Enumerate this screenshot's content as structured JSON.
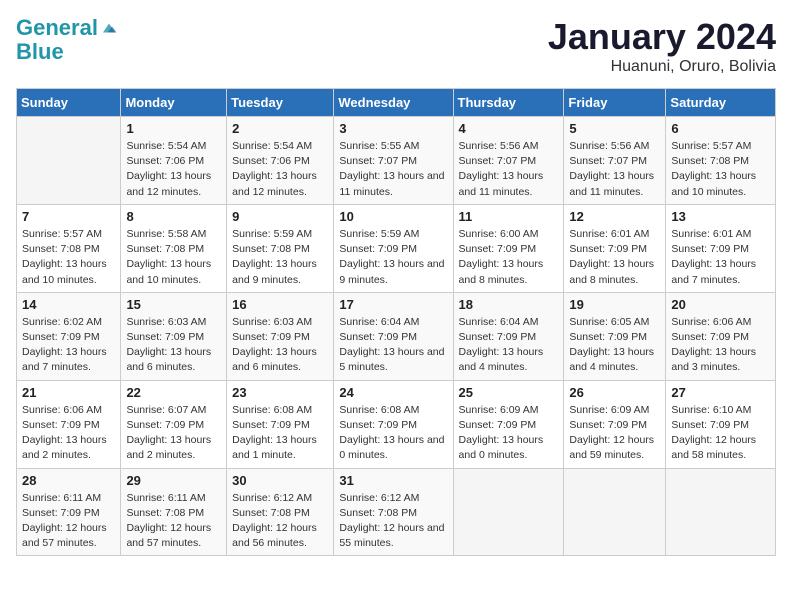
{
  "logo": {
    "line1": "General",
    "line2": "Blue"
  },
  "title": "January 2024",
  "subtitle": "Huanuni, Oruro, Bolivia",
  "header_color": "#2970b8",
  "days_of_week": [
    "Sunday",
    "Monday",
    "Tuesday",
    "Wednesday",
    "Thursday",
    "Friday",
    "Saturday"
  ],
  "weeks": [
    [
      {
        "day": "",
        "sunrise": "",
        "sunset": "",
        "daylight": ""
      },
      {
        "day": "1",
        "sunrise": "Sunrise: 5:54 AM",
        "sunset": "Sunset: 7:06 PM",
        "daylight": "Daylight: 13 hours and 12 minutes."
      },
      {
        "day": "2",
        "sunrise": "Sunrise: 5:54 AM",
        "sunset": "Sunset: 7:06 PM",
        "daylight": "Daylight: 13 hours and 12 minutes."
      },
      {
        "day": "3",
        "sunrise": "Sunrise: 5:55 AM",
        "sunset": "Sunset: 7:07 PM",
        "daylight": "Daylight: 13 hours and 11 minutes."
      },
      {
        "day": "4",
        "sunrise": "Sunrise: 5:56 AM",
        "sunset": "Sunset: 7:07 PM",
        "daylight": "Daylight: 13 hours and 11 minutes."
      },
      {
        "day": "5",
        "sunrise": "Sunrise: 5:56 AM",
        "sunset": "Sunset: 7:07 PM",
        "daylight": "Daylight: 13 hours and 11 minutes."
      },
      {
        "day": "6",
        "sunrise": "Sunrise: 5:57 AM",
        "sunset": "Sunset: 7:08 PM",
        "daylight": "Daylight: 13 hours and 10 minutes."
      }
    ],
    [
      {
        "day": "7",
        "sunrise": "Sunrise: 5:57 AM",
        "sunset": "Sunset: 7:08 PM",
        "daylight": "Daylight: 13 hours and 10 minutes."
      },
      {
        "day": "8",
        "sunrise": "Sunrise: 5:58 AM",
        "sunset": "Sunset: 7:08 PM",
        "daylight": "Daylight: 13 hours and 10 minutes."
      },
      {
        "day": "9",
        "sunrise": "Sunrise: 5:59 AM",
        "sunset": "Sunset: 7:08 PM",
        "daylight": "Daylight: 13 hours and 9 minutes."
      },
      {
        "day": "10",
        "sunrise": "Sunrise: 5:59 AM",
        "sunset": "Sunset: 7:09 PM",
        "daylight": "Daylight: 13 hours and 9 minutes."
      },
      {
        "day": "11",
        "sunrise": "Sunrise: 6:00 AM",
        "sunset": "Sunset: 7:09 PM",
        "daylight": "Daylight: 13 hours and 8 minutes."
      },
      {
        "day": "12",
        "sunrise": "Sunrise: 6:01 AM",
        "sunset": "Sunset: 7:09 PM",
        "daylight": "Daylight: 13 hours and 8 minutes."
      },
      {
        "day": "13",
        "sunrise": "Sunrise: 6:01 AM",
        "sunset": "Sunset: 7:09 PM",
        "daylight": "Daylight: 13 hours and 7 minutes."
      }
    ],
    [
      {
        "day": "14",
        "sunrise": "Sunrise: 6:02 AM",
        "sunset": "Sunset: 7:09 PM",
        "daylight": "Daylight: 13 hours and 7 minutes."
      },
      {
        "day": "15",
        "sunrise": "Sunrise: 6:03 AM",
        "sunset": "Sunset: 7:09 PM",
        "daylight": "Daylight: 13 hours and 6 minutes."
      },
      {
        "day": "16",
        "sunrise": "Sunrise: 6:03 AM",
        "sunset": "Sunset: 7:09 PM",
        "daylight": "Daylight: 13 hours and 6 minutes."
      },
      {
        "day": "17",
        "sunrise": "Sunrise: 6:04 AM",
        "sunset": "Sunset: 7:09 PM",
        "daylight": "Daylight: 13 hours and 5 minutes."
      },
      {
        "day": "18",
        "sunrise": "Sunrise: 6:04 AM",
        "sunset": "Sunset: 7:09 PM",
        "daylight": "Daylight: 13 hours and 4 minutes."
      },
      {
        "day": "19",
        "sunrise": "Sunrise: 6:05 AM",
        "sunset": "Sunset: 7:09 PM",
        "daylight": "Daylight: 13 hours and 4 minutes."
      },
      {
        "day": "20",
        "sunrise": "Sunrise: 6:06 AM",
        "sunset": "Sunset: 7:09 PM",
        "daylight": "Daylight: 13 hours and 3 minutes."
      }
    ],
    [
      {
        "day": "21",
        "sunrise": "Sunrise: 6:06 AM",
        "sunset": "Sunset: 7:09 PM",
        "daylight": "Daylight: 13 hours and 2 minutes."
      },
      {
        "day": "22",
        "sunrise": "Sunrise: 6:07 AM",
        "sunset": "Sunset: 7:09 PM",
        "daylight": "Daylight: 13 hours and 2 minutes."
      },
      {
        "day": "23",
        "sunrise": "Sunrise: 6:08 AM",
        "sunset": "Sunset: 7:09 PM",
        "daylight": "Daylight: 13 hours and 1 minute."
      },
      {
        "day": "24",
        "sunrise": "Sunrise: 6:08 AM",
        "sunset": "Sunset: 7:09 PM",
        "daylight": "Daylight: 13 hours and 0 minutes."
      },
      {
        "day": "25",
        "sunrise": "Sunrise: 6:09 AM",
        "sunset": "Sunset: 7:09 PM",
        "daylight": "Daylight: 13 hours and 0 minutes."
      },
      {
        "day": "26",
        "sunrise": "Sunrise: 6:09 AM",
        "sunset": "Sunset: 7:09 PM",
        "daylight": "Daylight: 12 hours and 59 minutes."
      },
      {
        "day": "27",
        "sunrise": "Sunrise: 6:10 AM",
        "sunset": "Sunset: 7:09 PM",
        "daylight": "Daylight: 12 hours and 58 minutes."
      }
    ],
    [
      {
        "day": "28",
        "sunrise": "Sunrise: 6:11 AM",
        "sunset": "Sunset: 7:09 PM",
        "daylight": "Daylight: 12 hours and 57 minutes."
      },
      {
        "day": "29",
        "sunrise": "Sunrise: 6:11 AM",
        "sunset": "Sunset: 7:08 PM",
        "daylight": "Daylight: 12 hours and 57 minutes."
      },
      {
        "day": "30",
        "sunrise": "Sunrise: 6:12 AM",
        "sunset": "Sunset: 7:08 PM",
        "daylight": "Daylight: 12 hours and 56 minutes."
      },
      {
        "day": "31",
        "sunrise": "Sunrise: 6:12 AM",
        "sunset": "Sunset: 7:08 PM",
        "daylight": "Daylight: 12 hours and 55 minutes."
      },
      {
        "day": "",
        "sunrise": "",
        "sunset": "",
        "daylight": ""
      },
      {
        "day": "",
        "sunrise": "",
        "sunset": "",
        "daylight": ""
      },
      {
        "day": "",
        "sunrise": "",
        "sunset": "",
        "daylight": ""
      }
    ]
  ]
}
